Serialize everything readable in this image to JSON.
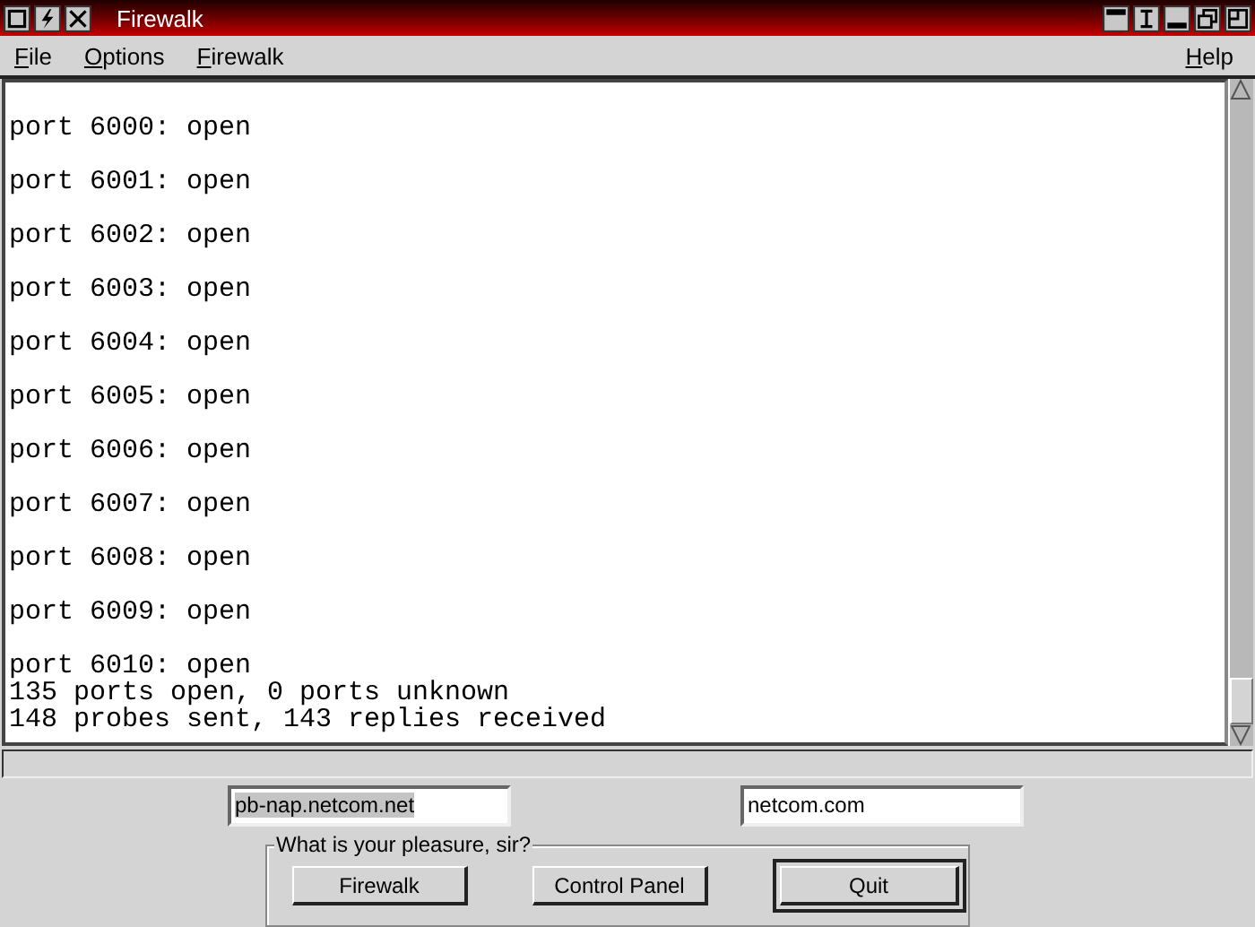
{
  "window": {
    "title": "Firewalk"
  },
  "menu": {
    "left": [
      "File",
      "Options",
      "Firewalk"
    ],
    "right": [
      "Help"
    ]
  },
  "output": {
    "lines": [
      {
        "kind": "port",
        "text": "port 6000: open"
      },
      {
        "kind": "port",
        "text": "port 6001: open"
      },
      {
        "kind": "port",
        "text": "port 6002: open"
      },
      {
        "kind": "port",
        "text": "port 6003: open"
      },
      {
        "kind": "port",
        "text": "port 6004: open"
      },
      {
        "kind": "port",
        "text": "port 6005: open"
      },
      {
        "kind": "port",
        "text": "port 6006: open"
      },
      {
        "kind": "port",
        "text": "port 6007: open"
      },
      {
        "kind": "port",
        "text": "port 6008: open"
      },
      {
        "kind": "port",
        "text": "port 6009: open"
      },
      {
        "kind": "summary",
        "text": "port 6010: open"
      },
      {
        "kind": "summary",
        "text": "135 ports open, 0 ports unknown"
      },
      {
        "kind": "summary",
        "text": "148 probes sent, 143 replies received"
      }
    ]
  },
  "fields": [
    {
      "value": "pb-nap.netcom.net",
      "text_selected": true
    },
    {
      "value": "netcom.com",
      "text_selected": false
    }
  ],
  "actions": {
    "legend": "What is your pleasure, sir?",
    "buttons": [
      {
        "label": "Firewalk",
        "default": false
      },
      {
        "label": "Control Panel",
        "default": false
      },
      {
        "label": "Quit",
        "default": true
      }
    ]
  }
}
